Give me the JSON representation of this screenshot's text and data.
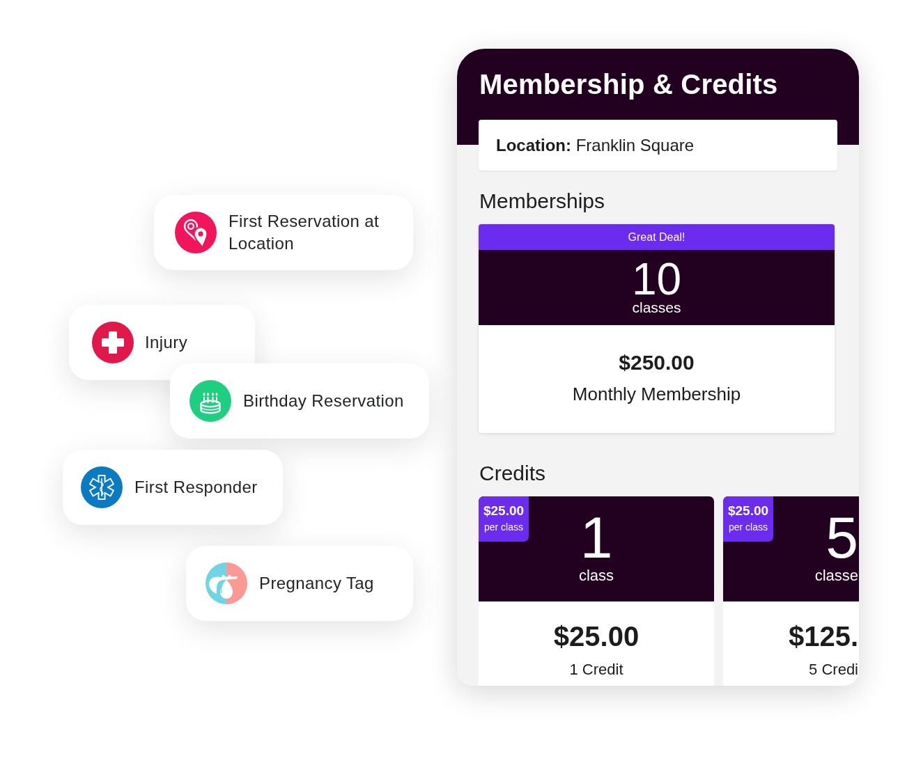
{
  "tags": [
    {
      "label": "First Reservation at Location"
    },
    {
      "label": "Injury"
    },
    {
      "label": "Birthday Reservation"
    },
    {
      "label": "First Responder"
    },
    {
      "label": "Pregnancy Tag"
    }
  ],
  "panel": {
    "title": "Membership & Credits",
    "location": "**Location:** Franklin Square",
    "memberships": {
      "heading": "Memberships",
      "cards": [
        {
          "badge": "Great Deal!",
          "count": "10",
          "unit": "classes",
          "price": "$250.00",
          "name": "Monthly Membership"
        }
      ]
    },
    "credits": {
      "heading": "Credits",
      "cards": [
        {
          "badge_price": "$25.00",
          "badge_unit": "per class",
          "count": "1",
          "unit": "class",
          "price": "$25.00",
          "credits": "1 Credit"
        },
        {
          "badge_price": "$25.00",
          "badge_unit": "per class",
          "count": "5",
          "unit": "classe",
          "price": "$125.",
          "credits": "5 Credi"
        }
      ]
    }
  }
}
